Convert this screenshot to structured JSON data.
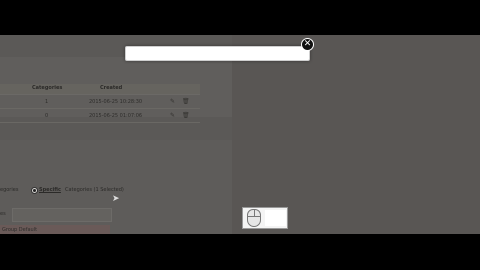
{
  "table": {
    "headers": {
      "categories": "Categories",
      "created": "Created"
    },
    "rows": [
      {
        "categories": "1",
        "created": "2015-06-25 10:28:30"
      },
      {
        "categories": "0",
        "created": "2015-06-25 01:07:06"
      }
    ]
  },
  "filter": {
    "prefix": "egories",
    "radio_label": "Specific",
    "radio_suffix": "Categories (1 Selected)"
  },
  "bottom_strip_text": "Group Default",
  "field_label": "es",
  "modal": {
    "close_glyph": "✕"
  },
  "colors": {
    "overlay": "#595654",
    "modal_bg": "#ffffff",
    "close_bg": "#111111"
  }
}
